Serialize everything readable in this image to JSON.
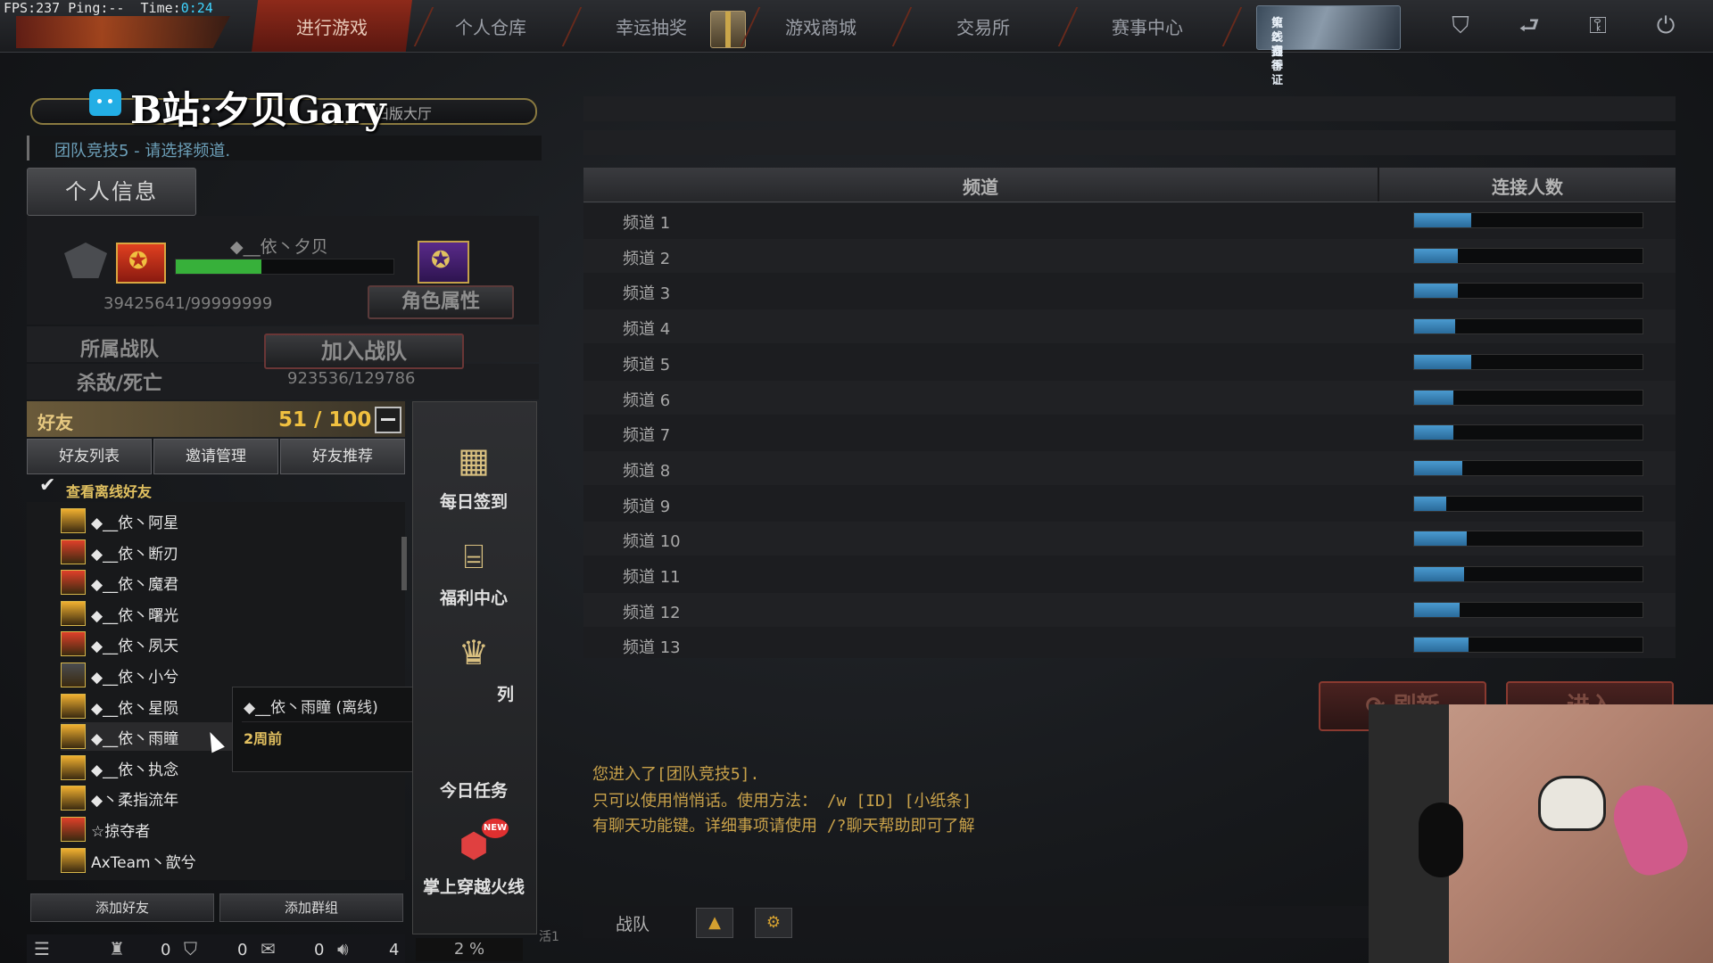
{
  "hud": {
    "fps_label": "FPS:",
    "fps_value": "237",
    "ping_label": "Ping:",
    "ping_value": "--",
    "time_label": "Time:",
    "time_value": "0:24"
  },
  "nav": {
    "items": [
      "进行游戏",
      "个人仓库",
      "幸运抽奖",
      "游戏商城",
      "交易所",
      "赛事中心"
    ],
    "active_index": 0,
    "banner_line1": "火线通行证",
    "banner_line2": "第2赛季",
    "icons": [
      "shield-icon",
      "exit-arrow-icon",
      "key-icon",
      "power-icon"
    ]
  },
  "header": {
    "watermark": "B站:夕贝Gary",
    "old_hall": "旧版大厅",
    "hint": "团队竞技5 - 请选择频道."
  },
  "profile": {
    "tab_label": "个人信息",
    "player_name": "◆__依丶夕贝",
    "xp_text": "39425641/99999999",
    "xp_fraction": 0.394,
    "role_button": "角色属性",
    "team_label": "所属战队",
    "join_team_button": "加入战队",
    "kd_label": "杀敌/死亡",
    "kd_value": "923536/129786"
  },
  "friends": {
    "title": "好友",
    "count": "51 / 100",
    "tabs": [
      "好友列表",
      "邀请管理",
      "好友推荐"
    ],
    "show_offline_label": "查看离线好友",
    "list": [
      {
        "name": "◆__依丶阿星",
        "color": "#f0b030"
      },
      {
        "name": "◆__依丶断刃",
        "color": "#e0402a"
      },
      {
        "name": "◆__依丶魔君",
        "color": "#e0402a"
      },
      {
        "name": "◆__依丶曙光",
        "color": "#f0b030"
      },
      {
        "name": "◆__依丶夙天",
        "color": "#e0402a"
      },
      {
        "name": "◆__依丶小兮",
        "color": "#4a4c50"
      },
      {
        "name": "◆__依丶星陨",
        "color": "#f0b030"
      },
      {
        "name": "◆__依丶雨瞳",
        "color": "#f0b030"
      },
      {
        "name": "◆__依丶执念",
        "color": "#f0b030"
      },
      {
        "name": "◆丶柔指流年",
        "color": "#f0b030"
      },
      {
        "name": "☆掠夺者",
        "color": "#e0402a"
      },
      {
        "name": "AxTeam丶歆兮",
        "color": "#f0b030"
      }
    ],
    "tooltip_name": "◆__依丶雨瞳 (离线)",
    "tooltip_time": "2周前",
    "add_friend": "添加好友",
    "add_group": "添加群组"
  },
  "quick_menu": {
    "items": [
      "每日签到",
      "福利中心",
      "列",
      "今日任务",
      "掌上穿越火线"
    ],
    "new_badge": "NEW"
  },
  "status": {
    "values": [
      "0",
      "0",
      "0",
      "4"
    ],
    "percent": "2 %",
    "side_tag": "活1"
  },
  "channels": {
    "col_channel": "频道",
    "col_connections": "连接人数",
    "rows": [
      {
        "name": "频道 1",
        "load": 0.25
      },
      {
        "name": "频道 2",
        "load": 0.19
      },
      {
        "name": "频道 3",
        "load": 0.19
      },
      {
        "name": "频道 4",
        "load": 0.18
      },
      {
        "name": "频道 5",
        "load": 0.25
      },
      {
        "name": "频道 6",
        "load": 0.17
      },
      {
        "name": "频道 7",
        "load": 0.17
      },
      {
        "name": "频道 8",
        "load": 0.21
      },
      {
        "name": "频道 9",
        "load": 0.14
      },
      {
        "name": "频道 10",
        "load": 0.23
      },
      {
        "name": "频道 11",
        "load": 0.22
      },
      {
        "name": "频道 12",
        "load": 0.2
      },
      {
        "name": "频道 13",
        "load": 0.24
      }
    ],
    "refresh_button": "刷新",
    "enter_button": "进入"
  },
  "chat": {
    "messages": [
      "您进入了[团队竞技5].",
      "只可以使用悄悄话。使用方法： /w [ID] [小纸条]",
      "有聊天功能键。详细事项请使用 /?聊天帮助即可了解"
    ],
    "channel_label": "战队"
  }
}
